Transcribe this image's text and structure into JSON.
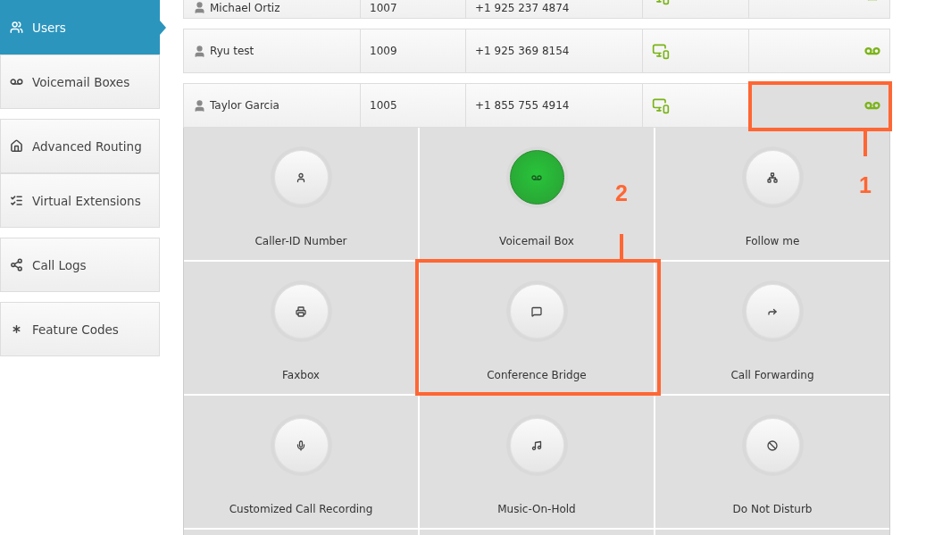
{
  "sidebar": {
    "groups": [
      {
        "items": [
          {
            "label": "Users",
            "selected": true
          },
          {
            "label": "Voicemail Boxes",
            "selected": false
          }
        ]
      },
      {
        "items": [
          {
            "label": "Advanced Routing",
            "selected": false
          },
          {
            "label": "Virtual Extensions",
            "selected": false
          }
        ]
      },
      {
        "items": [
          {
            "label": "Call Logs",
            "selected": false
          }
        ]
      },
      {
        "items": [
          {
            "label": "Feature Codes",
            "selected": false
          }
        ]
      }
    ]
  },
  "users": {
    "rows": [
      {
        "name": "Michael Ortiz",
        "extension": "1007",
        "phone": "+1 925 237 4874",
        "voicemail_selected": false
      },
      {
        "name": "Ryu test",
        "extension": "1009",
        "phone": "+1 925 369 8154",
        "voicemail_selected": false
      },
      {
        "name": "Taylor Garcia",
        "extension": "1005",
        "phone": "+1 855 755 4914",
        "voicemail_selected": true
      }
    ]
  },
  "features": [
    {
      "label": "Caller-ID Number",
      "selected": false
    },
    {
      "label": "Voicemail Box",
      "selected": true
    },
    {
      "label": "Follow me",
      "selected": false
    },
    {
      "label": "Faxbox",
      "selected": false
    },
    {
      "label": "Conference Bridge",
      "selected": false
    },
    {
      "label": "Call Forwarding",
      "selected": false
    },
    {
      "label": "Customized Call Recording",
      "selected": false
    },
    {
      "label": "Music-On-Hold",
      "selected": false
    },
    {
      "label": "Do Not Disturb",
      "selected": false
    }
  ],
  "annotations": [
    {
      "label": "1"
    },
    {
      "label": "2"
    }
  ]
}
